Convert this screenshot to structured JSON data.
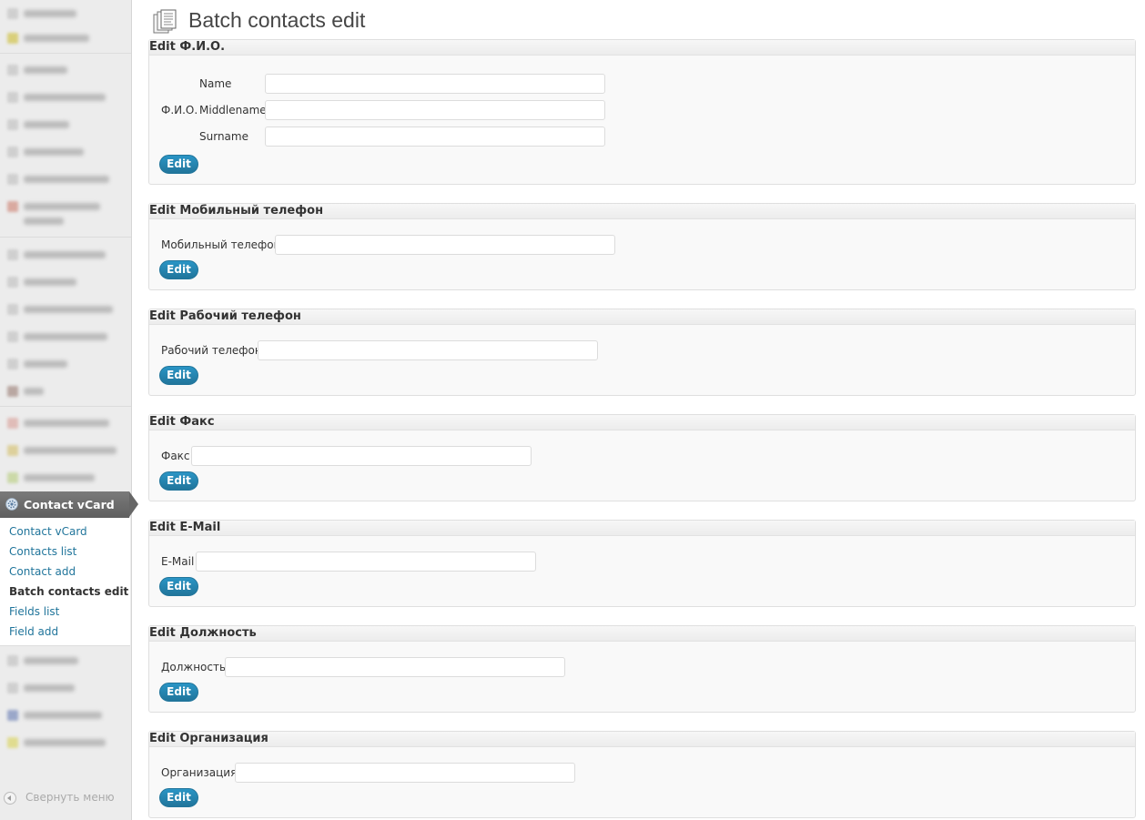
{
  "sidebar": {
    "current_menu": {
      "label": "Contact vCard",
      "icon": "gear-icon"
    },
    "submenu": [
      {
        "label": "Contact vCard",
        "current": false
      },
      {
        "label": "Contacts list",
        "current": false
      },
      {
        "label": "Contact add",
        "current": false
      },
      {
        "label": "Batch contacts edit",
        "current": true
      },
      {
        "label": "Fields list",
        "current": false
      },
      {
        "label": "Field add",
        "current": false
      }
    ],
    "collapse_label": "Свернуть меню"
  },
  "page": {
    "title": "Batch contacts edit",
    "title_icon": "document-icon"
  },
  "sections": [
    {
      "title": "Edit Ф.И.О.",
      "group_label": "Ф.И.О.",
      "fields": [
        {
          "label": "Name",
          "value": ""
        },
        {
          "label": "Middlename",
          "value": ""
        },
        {
          "label": "Surname",
          "value": ""
        }
      ],
      "button": "Edit"
    },
    {
      "title": "Edit Мобильный телефон",
      "fields": [
        {
          "label": "Мобильный телефон",
          "value": ""
        }
      ],
      "button": "Edit"
    },
    {
      "title": "Edit Рабочий телефон",
      "fields": [
        {
          "label": "Рабочий телефон",
          "value": ""
        }
      ],
      "button": "Edit"
    },
    {
      "title": "Edit Факс",
      "fields": [
        {
          "label": "Факс",
          "value": ""
        }
      ],
      "button": "Edit"
    },
    {
      "title": "Edit E-Mail",
      "fields": [
        {
          "label": "E-Mail",
          "value": ""
        }
      ],
      "button": "Edit"
    },
    {
      "title": "Edit Должность",
      "fields": [
        {
          "label": "Должность",
          "value": ""
        }
      ],
      "button": "Edit"
    },
    {
      "title": "Edit Организация",
      "fields": [
        {
          "label": "Организация",
          "value": ""
        }
      ],
      "button": "Edit"
    }
  ],
  "colors": {
    "link": "#21759b",
    "button": "#21759b",
    "current_menu": "#6d6d6d"
  }
}
